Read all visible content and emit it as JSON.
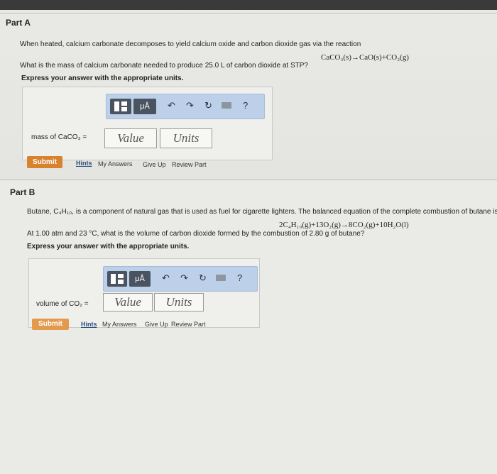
{
  "partA": {
    "title": "Part A",
    "line1": "When heated, calcium carbonate decomposes to yield calcium oxide and carbon dioxide gas via the reaction",
    "equation": "CaCO₃(s)→CaO(s)+CO₂(g)",
    "line2": "What is the mass of calcium carbonate needed to produce 25.0 L of carbon dioxide at STP?",
    "instruction": "Express your answer with the appropriate units.",
    "answer_label": "mass of CaCO₃ =",
    "value_placeholder": "Value",
    "units_placeholder": "Units",
    "submit": "Submit",
    "links": [
      "Hints",
      "My Answers",
      "Give Up",
      "Review Part"
    ]
  },
  "partB": {
    "title": "Part B",
    "line1": "Butane, C₄H₁₀, is a component of natural gas that is used as fuel for cigarette lighters. The balanced equation of the complete combustion of butane is",
    "equation": "2C₄H₁₀(g)+13O₂(g)→8CO₂(g)+10H₂O(l)",
    "line2": "At 1.00 atm and 23 °C, what is the volume of carbon dioxide formed by the combustion of 2.80 g of butane?",
    "instruction": "Express your answer with the appropriate units.",
    "answer_label": "volume of CO₂ =",
    "value_placeholder": "Value",
    "units_placeholder": "Units",
    "submit": "Submit",
    "links": [
      "Hints",
      "My Answers",
      "Give Up",
      "Review Part"
    ]
  },
  "toolbar": {
    "mu_label": "μÅ",
    "help_label": "?"
  }
}
